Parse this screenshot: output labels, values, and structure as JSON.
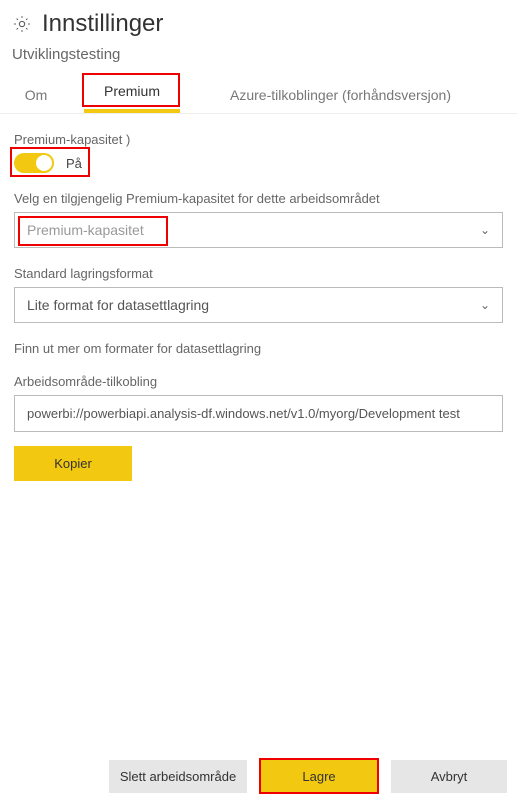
{
  "header": {
    "title": "Innstillinger",
    "subtitle": "Utviklingstesting"
  },
  "tabs": {
    "about": "Om",
    "premium": "Premium",
    "azure": "Azure-tilkoblinger (forhåndsversjon)"
  },
  "premium": {
    "capacity_label": "Premium-kapasitet   )",
    "toggle_state": "På",
    "select_label": "Velg en tilgjengelig Premium-kapasitet for dette arbeidsområdet",
    "select_value": "Premium-kapasitet",
    "storage_label": "Standard lagringsformat",
    "storage_value": "Lite format for datasettlagring",
    "storage_link": "Finn ut mer om formater for datasettlagring",
    "connection_label": "Arbeidsområde-tilkobling",
    "connection_value": "powerbi://powerbiapi.analysis-df.windows.net/v1.0/myorg/Development test",
    "copy_btn": "Kopier"
  },
  "footer": {
    "delete": "Slett arbeidsområde",
    "save": "Lagre",
    "cancel": "Avbryt"
  }
}
